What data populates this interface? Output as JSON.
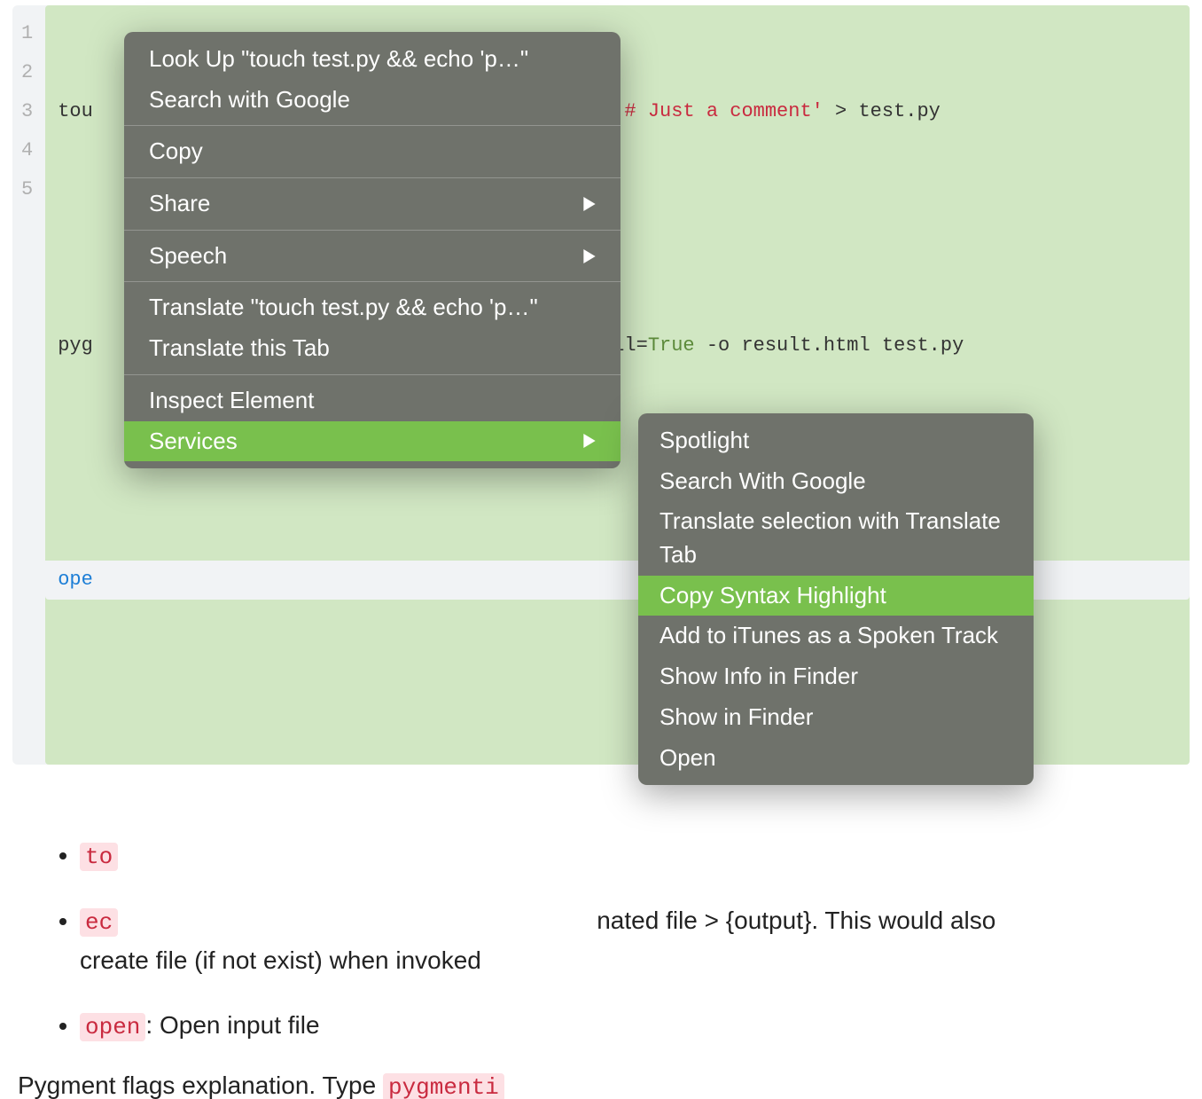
{
  "code": {
    "lines": [
      "1",
      "2",
      "3",
      "4",
      "5"
    ],
    "l1_pre": "tou",
    "l1_str": "\") # Just a comment'",
    "l1_post": " > test.py",
    "l3_pre": "pyg",
    "l3_mid": "full=",
    "l3_true": "True",
    "l3_post": " -o result.html test.py",
    "l5_open": "ope"
  },
  "clipboard_icon_name": "clipboard-icon",
  "menu": {
    "lookup": "Look Up \"touch test.py && echo 'p…\"",
    "search_google": "Search with Google",
    "copy": "Copy",
    "share": "Share",
    "speech": "Speech",
    "translate": "Translate \"touch test.py && echo 'p…\"",
    "translate_tab": "Translate this Tab",
    "inspect": "Inspect Element",
    "services": "Services"
  },
  "submenu": {
    "spotlight": "Spotlight",
    "search_google": "Search With Google",
    "translate_sel": "Translate selection with Translate Tab",
    "copy_syntax": "Copy Syntax Highlight",
    "add_itunes": "Add to iTunes as a Spoken Track",
    "show_info": "Show Info in Finder",
    "show_finder": "Show in Finder",
    "open": "Open"
  },
  "list": {
    "touch_code": "to",
    "echo_code": "ec",
    "echo_text_mid": "nated file > {output}. This would also",
    "echo_text2": "create file (if not exist) when invoked",
    "open_code": "open",
    "open_text": ": Open input file"
  },
  "para": {
    "pre": "Pygment flags explanation. Type ",
    "code": "pygmenti"
  }
}
